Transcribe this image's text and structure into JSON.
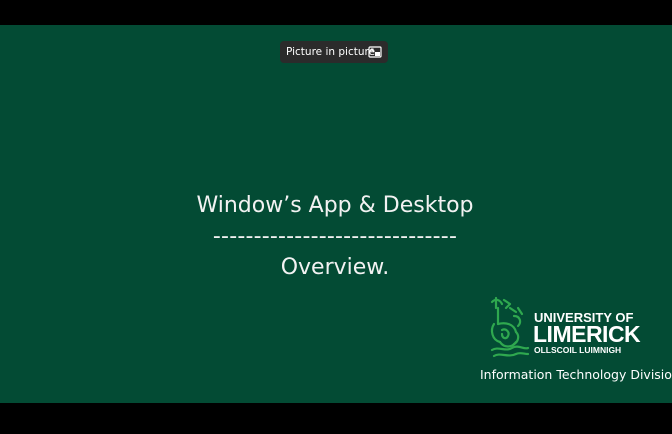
{
  "player": {
    "pip_button_label": "Picture in picture",
    "pip_icon": "picture-in-picture-icon",
    "background_color": "#000000"
  },
  "slide": {
    "background_color": "#034b34",
    "title": "Window’s App & Desktop",
    "separator": "------------------------------",
    "subtitle": "Overview.",
    "logo": {
      "line1": "UNIVERSITY OF",
      "line2": "LIMERICK",
      "line3": "OLLSCOIL LUIMNIGH",
      "accent_color": "#2fa84f"
    },
    "division": "Information Technology Division"
  }
}
